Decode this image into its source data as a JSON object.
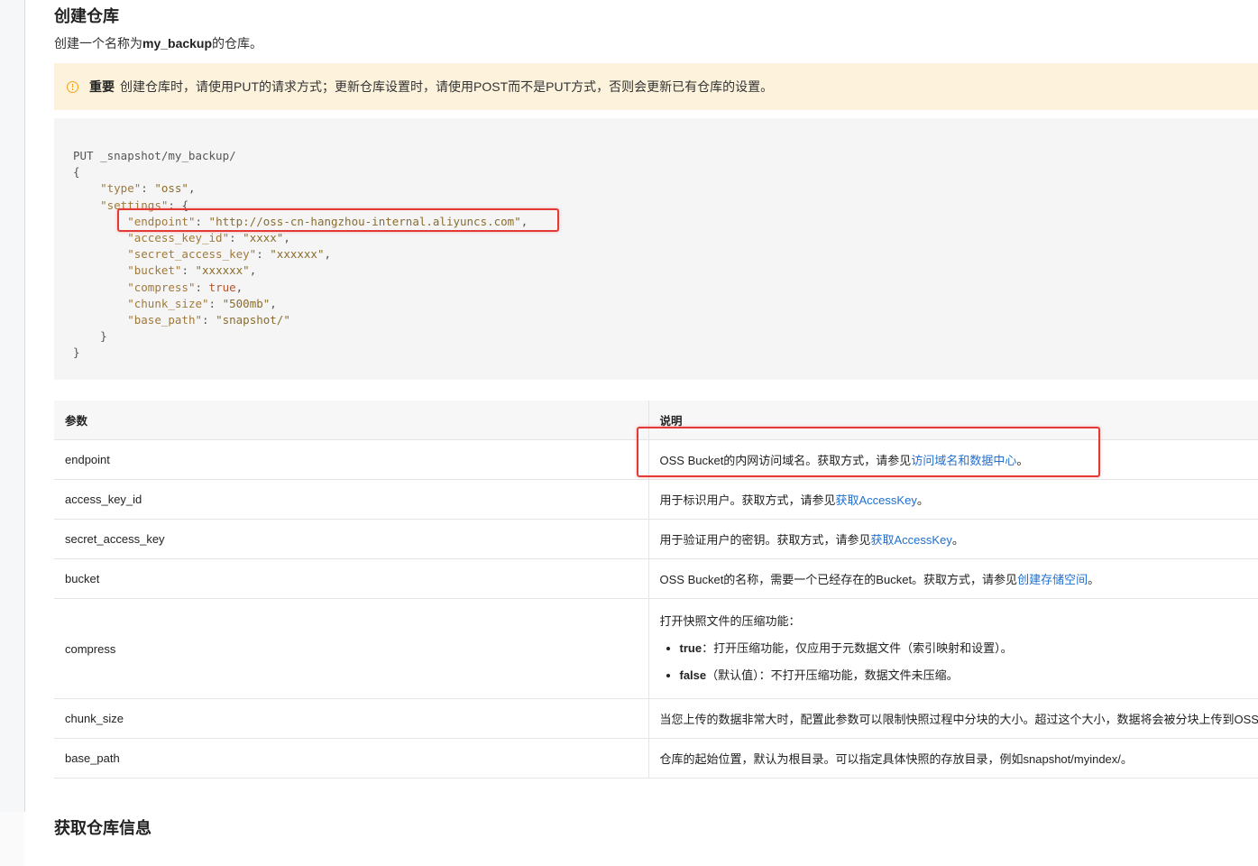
{
  "section": {
    "title": "创建仓库",
    "intro_prefix": "创建一个名称为",
    "intro_name": "my_backup",
    "intro_suffix": "的仓库。"
  },
  "notice": {
    "icon": "warning-circle-icon",
    "label": "重要",
    "text": "创建仓库时，请使用PUT的请求方式；更新仓库设置时，请使用POST而不是PUT方式，否则会更新已有仓库的设置。"
  },
  "code": {
    "request_line": "PUT _snapshot/my_backup/",
    "open_brace": "{",
    "type_key": "\"type\"",
    "type_val": "\"oss\"",
    "settings_key": "\"settings\"",
    "settings_open": "{",
    "endpoint_key": "\"endpoint\"",
    "endpoint_val": "\"http://oss-cn-hangzhou-internal.aliyuncs.com\"",
    "access_key_id_key": "\"access_key_id\"",
    "access_key_id_val": "\"xxxx\"",
    "secret_access_key_key": "\"secret_access_key\"",
    "secret_access_key_val": "\"xxxxxx\"",
    "bucket_key": "\"bucket\"",
    "bucket_val": "\"xxxxxx\"",
    "compress_key": "\"compress\"",
    "compress_val": "true",
    "chunk_size_key": "\"chunk_size\"",
    "chunk_size_val": "\"500mb\"",
    "base_path_key": "\"base_path\"",
    "base_path_val": "\"snapshot/\"",
    "settings_close": "}",
    "close_brace": "}"
  },
  "table": {
    "headers": [
      "参数",
      "说明"
    ],
    "rows": [
      {
        "param": "endpoint",
        "desc_text": "OSS Bucket的内网访问域名。获取方式，请参见",
        "desc_link": "访问域名和数据中心",
        "desc_end": "。"
      },
      {
        "param": "access_key_id",
        "desc_text": "用于标识用户。获取方式，请参见",
        "desc_link": "获取AccessKey",
        "desc_end": "。"
      },
      {
        "param": "secret_access_key",
        "desc_text": "用于验证用户的密钥。获取方式，请参见",
        "desc_link": "获取AccessKey",
        "desc_end": "。"
      },
      {
        "param": "bucket",
        "desc_text": "OSS Bucket的名称，需要一个已经存在的Bucket。获取方式，请参见",
        "desc_link": "创建存储空间",
        "desc_end": "。"
      },
      {
        "param": "compress",
        "desc_intro": "打开快照文件的压缩功能：",
        "bullets": [
          {
            "term": "true",
            "text": "：打开压缩功能，仅应用于元数据文件（索引映射和设置）。"
          },
          {
            "term": "false",
            "text": "（默认值）：不打开压缩功能，数据文件未压缩。"
          }
        ]
      },
      {
        "param": "chunk_size",
        "desc_text": "当您上传的数据非常大时，配置此参数可以限制快照过程中分块的大小。超过这个大小，数据将会被分块上传到OSS中。"
      },
      {
        "param": "base_path",
        "desc_text": "仓库的起始位置，默认为根目录。可以指定具体快照的存放目录，例如snapshot/myindex/。"
      }
    ]
  },
  "next_section": {
    "title": "获取仓库信息"
  },
  "highlight_color": "#e53935",
  "link_color": "#1f6fd1",
  "notice_bg": "#fdf3dc"
}
